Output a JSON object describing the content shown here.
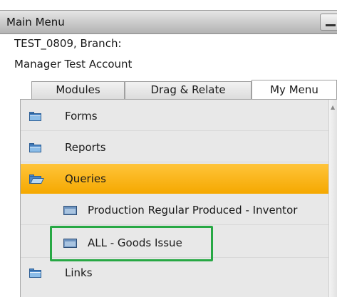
{
  "window": {
    "title": "Main Menu"
  },
  "company": {
    "line1": "TEST_0809, Branch:",
    "line2": "Manager Test Account"
  },
  "tabs": [
    {
      "label": "Modules",
      "active": false
    },
    {
      "label": "Drag & Relate",
      "active": false
    },
    {
      "label": "My Menu",
      "active": true
    }
  ],
  "menu": {
    "items": [
      {
        "label": "Forms",
        "type": "folder",
        "icon": "folder-icon"
      },
      {
        "label": "Reports",
        "type": "folder",
        "icon": "folder-icon"
      },
      {
        "label": "Queries",
        "type": "folder-open",
        "icon": "folder-open-icon",
        "selected": true
      },
      {
        "label": "Production Regular Produced - Inventor",
        "type": "query",
        "icon": "query-icon"
      },
      {
        "label": "ALL - Goods Issue",
        "type": "query",
        "icon": "query-icon",
        "highlighted": true
      },
      {
        "label": "Links",
        "type": "folder",
        "icon": "folder-icon"
      }
    ]
  },
  "colors": {
    "selected_row": "#f5a800",
    "highlight_box": "#27a844",
    "panel_bg": "#e8e8e8",
    "folder_blue": "#4a86c6"
  }
}
